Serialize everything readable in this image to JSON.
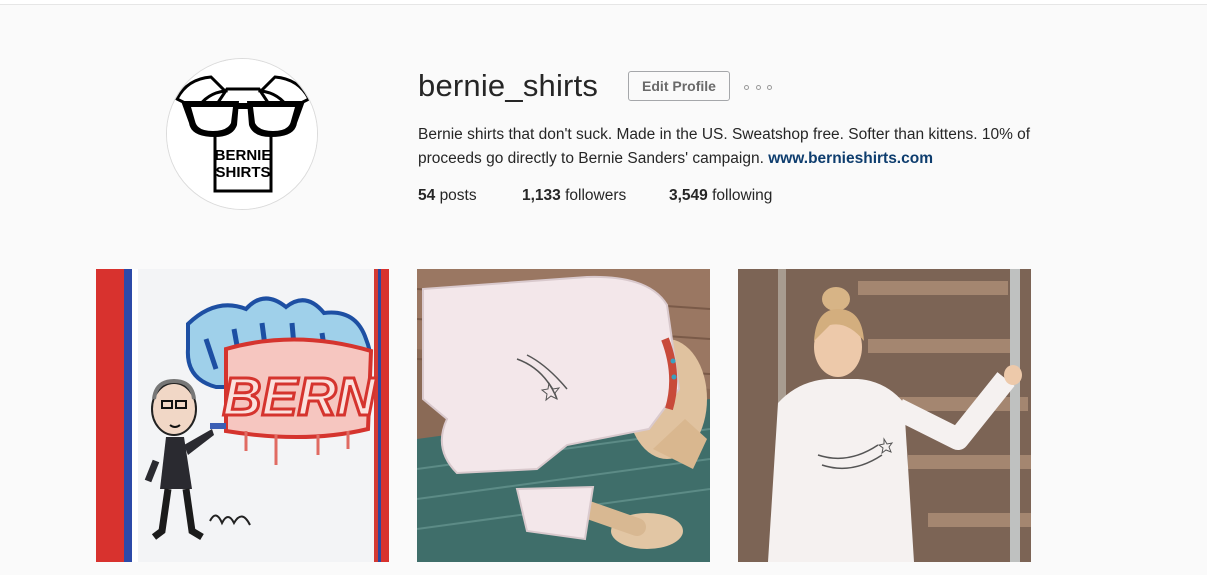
{
  "profile": {
    "username": "bernie_shirts",
    "edit_label": "Edit Profile",
    "more_icon": "ellipsis-icon",
    "bio_text": "Bernie shirts that don't suck. Made in the US. Sweatshop free. Softer than kittens. 10% of proceeds go directly to Bernie Sanders' campaign.",
    "website": "www.bernieshirts.com",
    "avatar_text_line1": "BERNIE",
    "avatar_text_line2": "SHIRTS"
  },
  "stats": {
    "posts_count": "54",
    "posts_label": "posts",
    "followers_count": "1,133",
    "followers_label": "followers",
    "following_count": "3,549",
    "following_label": "following"
  },
  "posts": [
    {
      "subject": "graffiti-art-feel-the-bern",
      "graffiti_text": "BERN"
    },
    {
      "subject": "dog-wearing-shirt"
    },
    {
      "subject": "woman-wearing-shirt"
    }
  ],
  "colors": {
    "link": "#0e3d6e",
    "text": "#262626",
    "background": "#fafafa"
  }
}
